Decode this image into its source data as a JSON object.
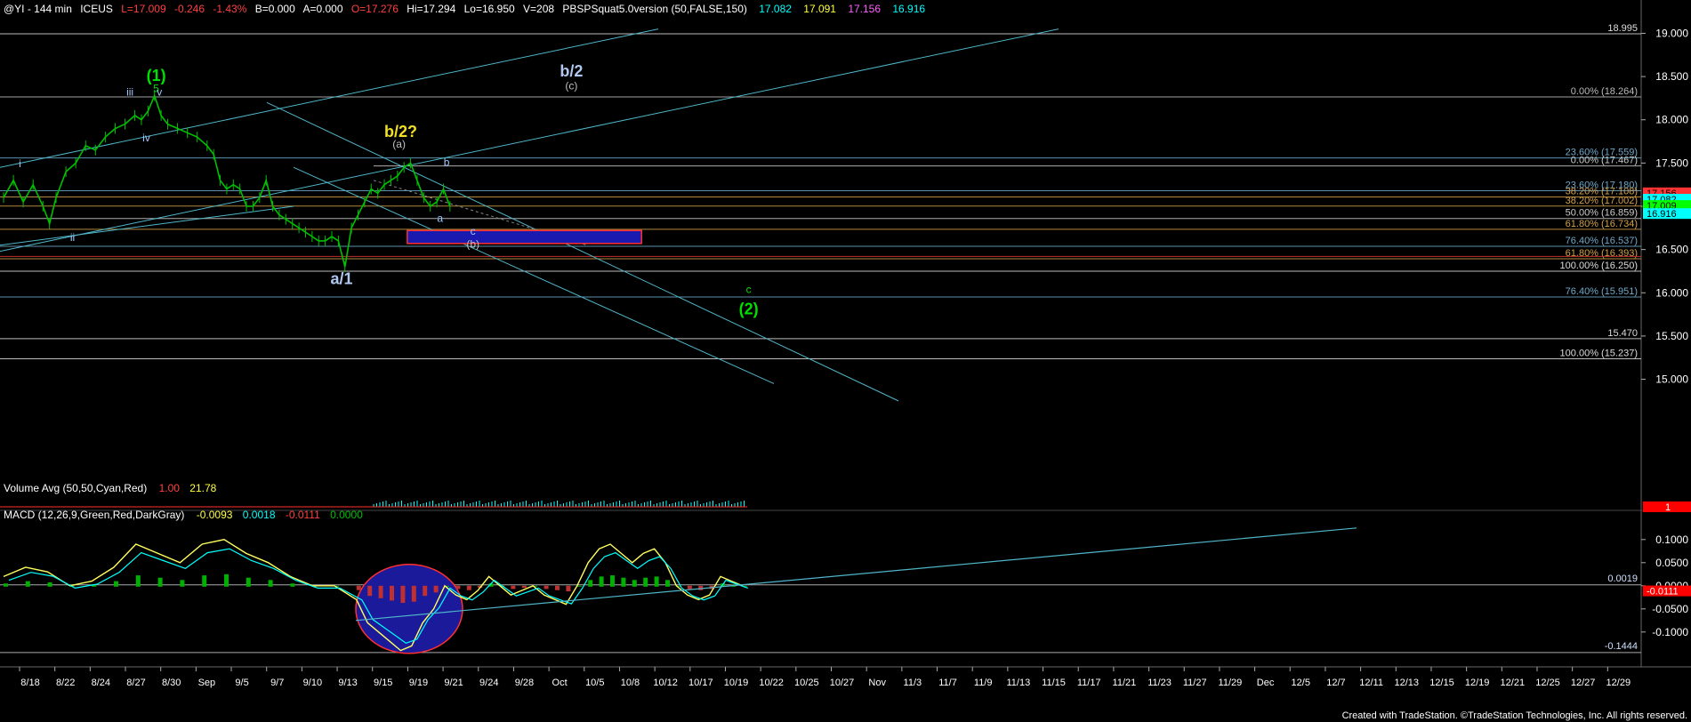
{
  "header": {
    "symbol": "@YI - 144 min",
    "exchange": "ICEUS",
    "last": "L=17.009",
    "change": "-0.246",
    "change_pct": "-1.43%",
    "bid": "B=0.000",
    "ask": "A=0.000",
    "open": "O=17.276",
    "high": "Hi=17.294",
    "low": "Lo=16.950",
    "volume": "V=208",
    "study": "PBSPSquat5.0version (50,FALSE,150)",
    "values": [
      "17.082",
      "17.091",
      "17.156",
      "16.916"
    ]
  },
  "chart_data": [
    {
      "type": "line",
      "title": "@YI - 144 min",
      "y_axis_ticks": [
        15.0,
        15.5,
        16.0,
        16.5,
        17.0,
        17.5,
        18.0,
        18.5,
        19.0
      ],
      "y_axis_labels": [
        "15.000",
        "15.500",
        "16.000",
        "16.500",
        "17.000",
        "17.500",
        "18.000",
        "18.500",
        "19.000"
      ],
      "ylim": [
        14.8,
        19.2
      ],
      "x_axis_labels": [
        "8/18",
        "8/22",
        "8/24",
        "8/27",
        "8/30",
        "Sep",
        "9/5",
        "9/7",
        "9/10",
        "9/13",
        "9/15",
        "9/19",
        "9/21",
        "9/24",
        "9/28",
        "Oct",
        "10/5",
        "10/8",
        "10/12",
        "10/17",
        "10/19",
        "10/22",
        "10/25",
        "10/27",
        "Nov",
        "11/3",
        "11/7",
        "11/9",
        "11/13",
        "11/15",
        "11/17",
        "11/21",
        "11/23",
        "11/27",
        "11/29",
        "Dec",
        "12/5",
        "12/7",
        "12/11",
        "12/13",
        "12/15",
        "12/19",
        "12/21",
        "12/25",
        "12/27",
        "12/29"
      ],
      "price_series": [
        [
          0,
          17.1
        ],
        [
          3,
          17.3
        ],
        [
          6,
          17.05
        ],
        [
          9,
          17.25
        ],
        [
          12,
          17.0
        ],
        [
          14,
          16.8
        ],
        [
          16,
          17.1
        ],
        [
          19,
          17.4
        ],
        [
          22,
          17.5
        ],
        [
          25,
          17.7
        ],
        [
          28,
          17.65
        ],
        [
          31,
          17.8
        ],
        [
          34,
          17.9
        ],
        [
          37,
          17.95
        ],
        [
          40,
          18.05
        ],
        [
          42,
          18.0
        ],
        [
          44,
          18.1
        ],
        [
          46,
          18.28
        ],
        [
          48,
          18.05
        ],
        [
          50,
          17.95
        ],
        [
          53,
          17.9
        ],
        [
          56,
          17.85
        ],
        [
          59,
          17.8
        ],
        [
          62,
          17.7
        ],
        [
          64,
          17.6
        ],
        [
          66,
          17.3
        ],
        [
          68,
          17.2
        ],
        [
          70,
          17.25
        ],
        [
          72,
          17.2
        ],
        [
          74,
          17.0
        ],
        [
          76,
          17.0
        ],
        [
          78,
          17.1
        ],
        [
          80,
          17.3
        ],
        [
          82,
          17.0
        ],
        [
          84,
          16.9
        ],
        [
          86,
          16.85
        ],
        [
          88,
          16.8
        ],
        [
          90,
          16.75
        ],
        [
          92,
          16.7
        ],
        [
          94,
          16.65
        ],
        [
          96,
          16.6
        ],
        [
          98,
          16.6
        ],
        [
          100,
          16.65
        ],
        [
          102,
          16.6
        ],
        [
          104,
          16.3
        ],
        [
          106,
          16.75
        ],
        [
          108,
          16.9
        ],
        [
          110,
          17.05
        ],
        [
          112,
          17.2
        ],
        [
          114,
          17.15
        ],
        [
          116,
          17.25
        ],
        [
          118,
          17.3
        ],
        [
          120,
          17.35
        ],
        [
          122,
          17.45
        ],
        [
          124,
          17.5
        ],
        [
          126,
          17.3
        ],
        [
          128,
          17.1
        ],
        [
          130,
          17.0
        ],
        [
          132,
          17.05
        ],
        [
          134,
          17.2
        ],
        [
          136,
          17.0
        ]
      ],
      "price_y_scale": [
        14.8,
        19.2
      ],
      "price_x_scale": [
        0,
        300
      ],
      "fib_lines": [
        {
          "label": "0.00% (18.264)",
          "value": 18.264,
          "color": "#bbbbbb"
        },
        {
          "label": "23.60% (17.559)",
          "value": 17.559,
          "color": "#6fa8c8"
        },
        {
          "label": "0.00% (17.467)",
          "value": 17.467,
          "color": "#cccccc"
        },
        {
          "label": "23.60% (17.180)",
          "value": 17.18,
          "color": "#6fa8c8"
        },
        {
          "label": "38.20% (17.108)",
          "value": 17.108,
          "color": "#d2a04a"
        },
        {
          "label": "38.20% (17.002)",
          "value": 17.002,
          "color": "#d2a04a"
        },
        {
          "label": "50.00% (16.859)",
          "value": 16.859,
          "color": "#cccccc"
        },
        {
          "label": "61.80% (16.734)",
          "value": 16.734,
          "color": "#d2a04a"
        },
        {
          "label": "76.40% (16.537)",
          "value": 16.537,
          "color": "#6fa8c8"
        },
        {
          "label": "61.80% (16.393)",
          "value": 16.393,
          "color": "#d2a04a"
        },
        {
          "label": "100.00% (16.250)",
          "value": 16.25,
          "color": "#dddddd"
        },
        {
          "label": "76.40% (15.951)",
          "value": 15.951,
          "color": "#6fa8c8"
        },
        {
          "label": "15.470",
          "value": 15.47,
          "color": "#dddddd"
        },
        {
          "label": "100.00% (15.237)",
          "value": 15.237,
          "color": "#dddddd"
        },
        {
          "label": "18.995",
          "value": 18.995,
          "color": "#dddddd"
        }
      ],
      "price_tags": [
        {
          "value": 17.156,
          "color": "#ff3333"
        },
        {
          "value": 17.082,
          "color": "#00ffff"
        },
        {
          "value": 17.009,
          "color": "#00ff00"
        },
        {
          "value": 16.916,
          "color": "#00ffff"
        }
      ],
      "wave_labels": [
        {
          "text": "(1)",
          "color": "#00e000",
          "x": 46.5,
          "y": 18.45
        },
        {
          "text": "5",
          "color": "#00e000",
          "x": 46.5,
          "y": 18.32
        },
        {
          "text": "iii",
          "color": "#9ec8ff",
          "x": 38.5,
          "y": 18.28
        },
        {
          "text": "v",
          "color": "#9ec8ff",
          "x": 47.5,
          "y": 18.28
        },
        {
          "text": "iv",
          "color": "#9ec8ff",
          "x": 43.5,
          "y": 17.75
        },
        {
          "text": "i",
          "color": "#9ec8ff",
          "x": 5,
          "y": 17.45
        },
        {
          "text": "ii",
          "color": "#9ec8ff",
          "x": 21,
          "y": 16.6
        },
        {
          "text": "a/1",
          "color": "#b0c8f0",
          "x": 103,
          "y": 16.1
        },
        {
          "text": "b/2?",
          "color": "#f0e020",
          "x": 121,
          "y": 17.8
        },
        {
          "text": "(a)",
          "color": "#c0c0c0",
          "x": 120.5,
          "y": 17.68
        },
        {
          "text": "b",
          "color": "#9ec8ff",
          "x": 135,
          "y": 17.47
        },
        {
          "text": "a",
          "color": "#9ec8ff",
          "x": 133,
          "y": 16.82
        },
        {
          "text": "c",
          "color": "#9ec8ff",
          "x": 143,
          "y": 16.67
        },
        {
          "text": "(b)",
          "color": "#c0c0c0",
          "x": 143,
          "y": 16.52
        },
        {
          "text": "b/2",
          "color": "#b0c8f0",
          "x": 173,
          "y": 18.5
        },
        {
          "text": "(c)",
          "color": "#c0c0c0",
          "x": 173,
          "y": 18.35
        },
        {
          "text": "c",
          "color": "#00e000",
          "x": 227,
          "y": 16.0
        },
        {
          "text": "(2)",
          "color": "#00e000",
          "x": 227,
          "y": 15.75
        }
      ],
      "target_box": {
        "x1": 123,
        "x2": 151,
        "y1": 16.72,
        "y2": 16.57
      }
    },
    {
      "type": "bar",
      "title": "Volume Avg (50,50,Cyan,Red)",
      "values_text": [
        "1.00",
        "21.78"
      ],
      "marker": "1"
    },
    {
      "type": "line",
      "title": "MACD (12,26,9,Green,Red,DarkGray)",
      "values_text": [
        "-0.0093",
        "0.0018",
        "-0.0111",
        "0.0000"
      ],
      "y_axis_labels": [
        "0.1000",
        "0.0500",
        "0.0000",
        "-0.0500",
        "-0.1000"
      ],
      "y_axis_ticks": [
        0.1,
        0.05,
        0.0,
        -0.05,
        -0.1
      ],
      "ylim": [
        -0.16,
        0.14
      ],
      "annotations": [
        "0.0019",
        "-0.1444",
        "-0.0111"
      ],
      "macd_series": [
        [
          0,
          0.02
        ],
        [
          4,
          0.04
        ],
        [
          8,
          0.03
        ],
        [
          12,
          0.0
        ],
        [
          16,
          0.01
        ],
        [
          20,
          0.04
        ],
        [
          24,
          0.09
        ],
        [
          28,
          0.07
        ],
        [
          32,
          0.05
        ],
        [
          36,
          0.09
        ],
        [
          40,
          0.1
        ],
        [
          44,
          0.07
        ],
        [
          48,
          0.05
        ],
        [
          52,
          0.02
        ],
        [
          56,
          0.0
        ],
        [
          60,
          0.0
        ],
        [
          64,
          -0.03
        ],
        [
          66,
          -0.08
        ],
        [
          68,
          -0.1
        ],
        [
          70,
          -0.12
        ],
        [
          72,
          -0.14
        ],
        [
          74,
          -0.13
        ],
        [
          76,
          -0.08
        ],
        [
          78,
          -0.05
        ],
        [
          80,
          0.0
        ],
        [
          82,
          -0.02
        ],
        [
          84,
          -0.03
        ],
        [
          86,
          -0.01
        ],
        [
          88,
          0.02
        ],
        [
          90,
          0.0
        ],
        [
          92,
          -0.02
        ],
        [
          94,
          -0.01
        ],
        [
          96,
          0.0
        ],
        [
          98,
          -0.02
        ],
        [
          100,
          -0.03
        ],
        [
          102,
          -0.04
        ],
        [
          104,
          0.0
        ],
        [
          106,
          0.05
        ],
        [
          108,
          0.08
        ],
        [
          110,
          0.09
        ],
        [
          112,
          0.07
        ],
        [
          114,
          0.05
        ],
        [
          116,
          0.07
        ],
        [
          118,
          0.08
        ],
        [
          120,
          0.05
        ],
        [
          122,
          0.0
        ],
        [
          124,
          -0.02
        ],
        [
          126,
          -0.03
        ],
        [
          128,
          -0.02
        ],
        [
          130,
          0.02
        ],
        [
          132,
          0.01
        ],
        [
          134,
          0.0
        ]
      ]
    }
  ],
  "footer": {
    "credit": "Created with TradeStation. ©TradeStation Technologies, Inc. All rights reserved."
  }
}
